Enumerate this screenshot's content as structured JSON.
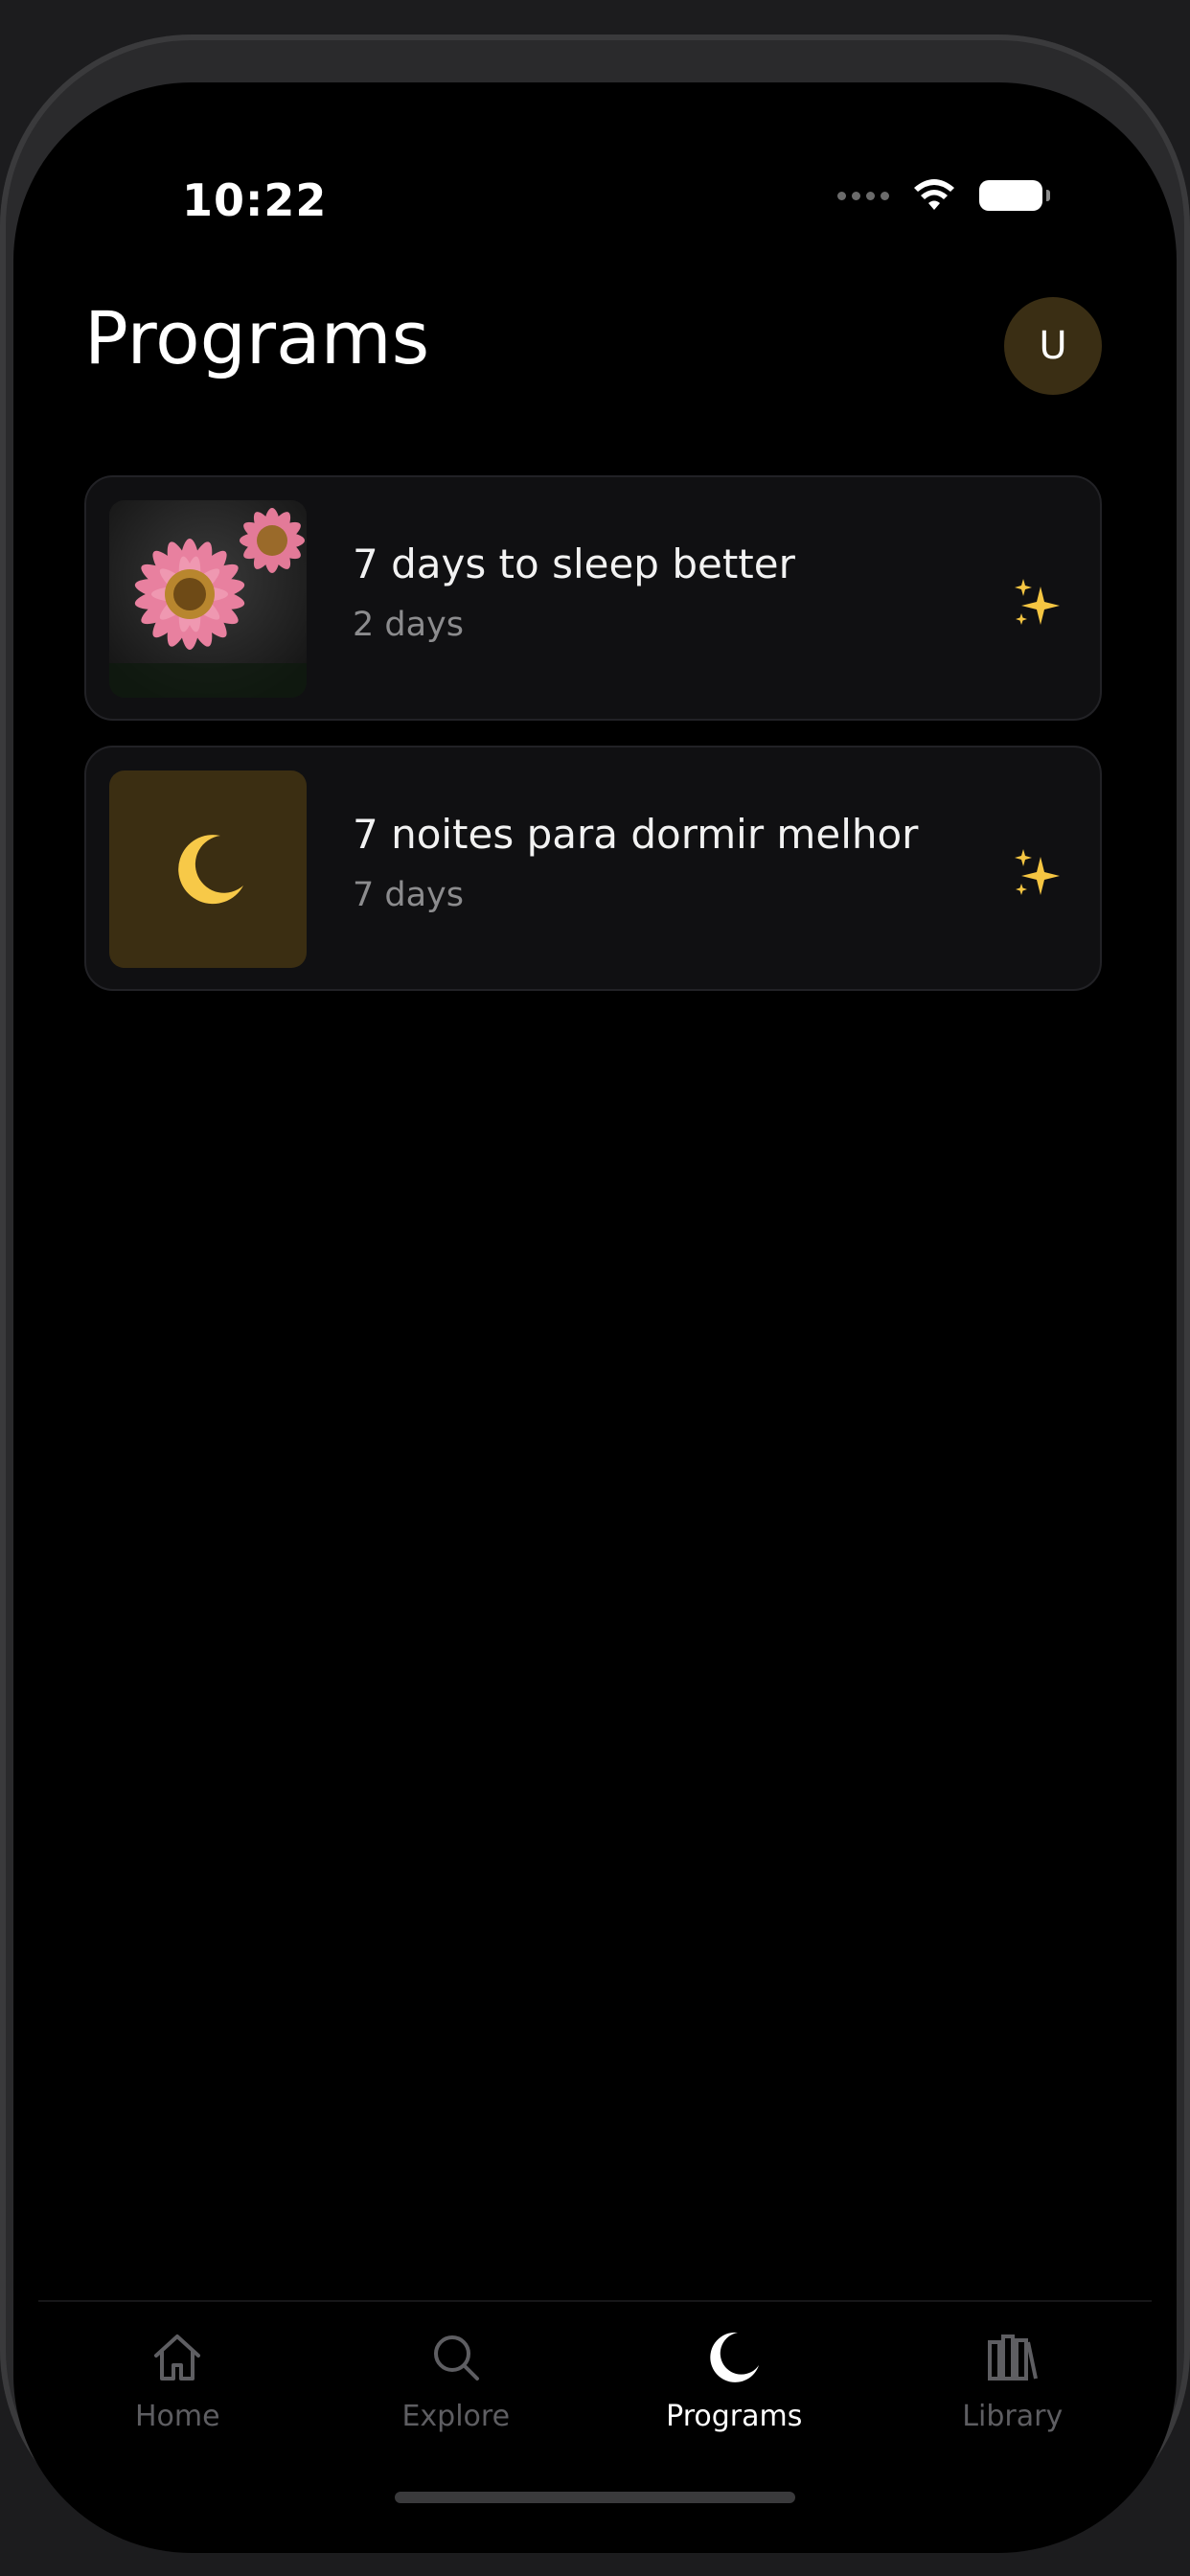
{
  "status_bar": {
    "time": "10:22"
  },
  "header": {
    "title": "Programs",
    "avatar_initial": "U"
  },
  "programs": [
    {
      "title": "7 days to sleep better",
      "subtitle": "2 days",
      "thumbnail_icon": "flower-image",
      "badge_icon": "sparkles-icon"
    },
    {
      "title": "7 noites para dormir melhor",
      "subtitle": "7 days",
      "thumbnail_icon": "crescent-moon-icon",
      "badge_icon": "sparkles-icon"
    }
  ],
  "tabbar": {
    "items": [
      {
        "label": "Home",
        "icon": "home-icon",
        "active": false
      },
      {
        "label": "Explore",
        "icon": "search-icon",
        "active": false
      },
      {
        "label": "Programs",
        "icon": "moon-icon",
        "active": true
      },
      {
        "label": "Library",
        "icon": "library-icon",
        "active": false
      }
    ]
  },
  "colors": {
    "background": "#000000",
    "card": "#101012",
    "accent": "#3b2e12",
    "sparkle": "#f5c542",
    "tab_inactive": "#5e5e62"
  }
}
